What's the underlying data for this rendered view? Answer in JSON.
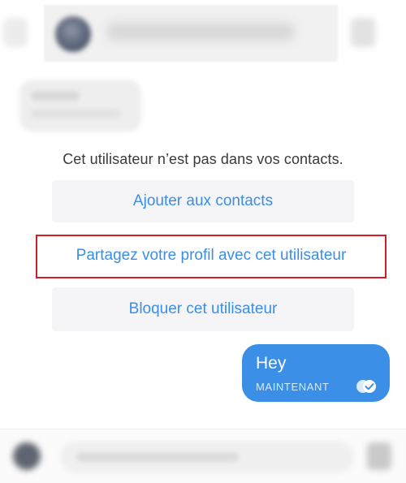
{
  "conversation": {
    "notice": "Cet utilisateur n’est pas dans vos contacts.",
    "actions": {
      "add_contact": "Ajouter aux contacts",
      "share_profile": "Partagez votre profil avec cet utilisateur",
      "block_user": "Bloquer cet utilisateur"
    },
    "outgoing_message": {
      "text": "Hey",
      "time": "MAINTENANT",
      "status_icon": "double-check-icon"
    }
  },
  "colors": {
    "accent": "#3a8ee6",
    "bubble": "#3b8fe6",
    "highlight_border": "#d21e2b",
    "card_background": "#f5f5f7"
  }
}
